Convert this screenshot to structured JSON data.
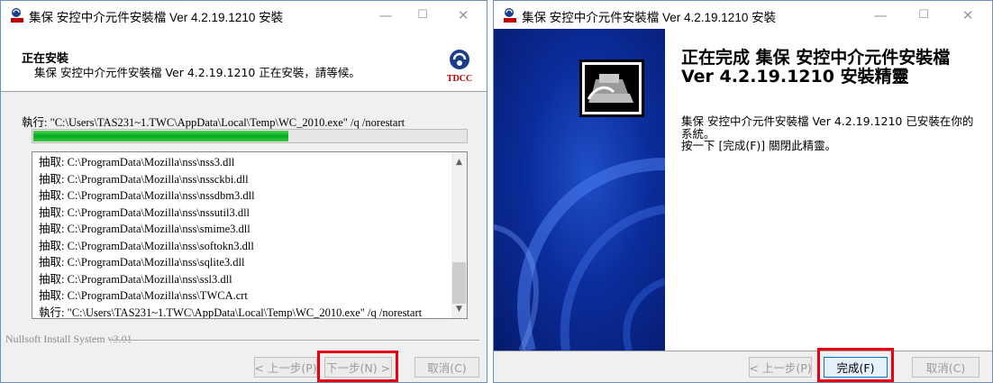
{
  "left_window": {
    "title": "集保 安控中介元件安裝檔 Ver 4.2.19.1210 安裝",
    "controls": {
      "minimize": "—",
      "maximize": "☐",
      "close": "✕"
    },
    "header_title": "正在安裝",
    "header_subtitle": "集保 安控中介元件安裝檔 Ver 4.2.19.1210 正在安裝，請等候。",
    "logo_text": "TDCC",
    "exec_line": "執行: \"C:\\Users\\TAS231~1.TWC\\AppData\\Local\\Temp\\WC_2010.exe\" /q /norestart",
    "progress": 0.59,
    "log_lines": [
      "抽取: C:\\ProgramData\\Mozilla\\nss\\nss3.dll",
      "抽取: C:\\ProgramData\\Mozilla\\nss\\nssckbi.dll",
      "抽取: C:\\ProgramData\\Mozilla\\nss\\nssdbm3.dll",
      "抽取: C:\\ProgramData\\Mozilla\\nss\\nssutil3.dll",
      "抽取: C:\\ProgramData\\Mozilla\\nss\\smime3.dll",
      "抽取: C:\\ProgramData\\Mozilla\\nss\\softokn3.dll",
      "抽取: C:\\ProgramData\\Mozilla\\nss\\sqlite3.dll",
      "抽取: C:\\ProgramData\\Mozilla\\nss\\ssl3.dll",
      "抽取: C:\\ProgramData\\Mozilla\\nss\\TWCA.crt",
      "執行: \"C:\\Users\\TAS231~1.TWC\\AppData\\Local\\Temp\\WC_2010.exe\" /q /norestart"
    ],
    "footer_brand": "Nullsoft Install System v3.01",
    "buttons": {
      "back": "< 上一步(P)",
      "next": "下一步(N) >",
      "cancel": "取消(C)"
    }
  },
  "right_window": {
    "title": "集保 安控中介元件安裝檔 Ver 4.2.19.1210 安裝",
    "controls": {
      "minimize": "—",
      "maximize": "☐",
      "close": "✕"
    },
    "finish_title_line1": "正在完成 集保 安控中介元件安裝檔",
    "finish_title_line2": "Ver 4.2.19.1210 安裝精靈",
    "finish_body_line1": "集保 安控中介元件安裝檔 Ver 4.2.19.1210 已安裝在你的",
    "finish_body_line2": "系統。",
    "finish_body_line3": "按一下 [完成(F)] 關閉此精靈。",
    "buttons": {
      "back": "< 上一步(P)",
      "finish": "完成(F)",
      "cancel": "取消(C)"
    }
  },
  "colors": {
    "highlight": "#e60012",
    "progress": "#06b025",
    "banner": "#0b2d9c"
  }
}
